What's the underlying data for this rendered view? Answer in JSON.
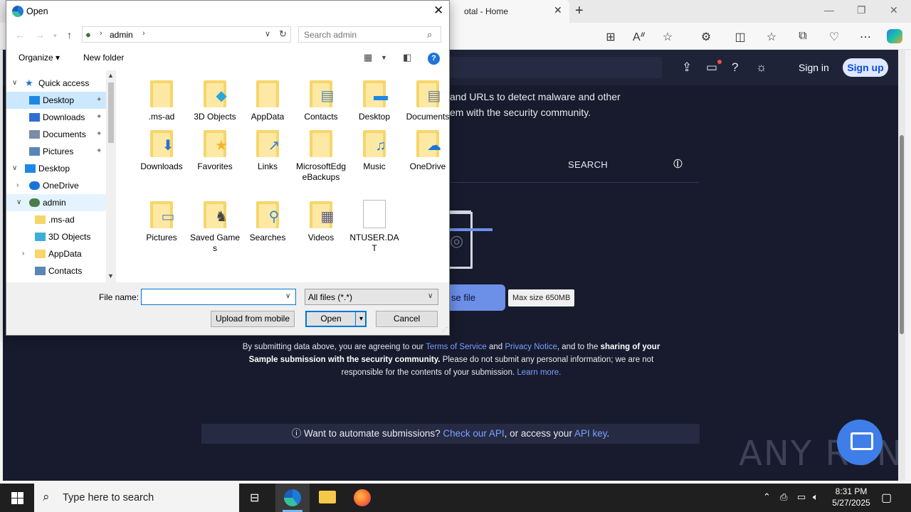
{
  "browser": {
    "tab_title": "otal - Home",
    "new_tab_symbol": "+",
    "window_controls": [
      "—",
      "❐",
      "✕"
    ]
  },
  "vt": {
    "sign_in": "Sign in",
    "sign_up": "Sign up",
    "intro_line1": "and URLs to detect malware and other",
    "intro_line2": "em with the security community.",
    "search_tab": "SEARCH",
    "choose_file": "se file",
    "max_size": "Max size 650MB",
    "consent": {
      "part1": "By submitting data above, you are agreeing to our ",
      "terms": "Terms of Service",
      "part2": " and ",
      "privacy": "Privacy Notice",
      "part3": ", and to the ",
      "bold1": "sharing of your Sample submission with the security community.",
      "part4": " Please do not submit any personal information; we are not responsible for the contents of your submission. ",
      "learn_more": "Learn more."
    },
    "api_banner": {
      "icon": "ⓘ",
      "text1": "Want to automate submissions? ",
      "link1": "Check our API",
      "text2": ", or access your ",
      "link2": "API key",
      "text3": "."
    },
    "watermark": "ANY RUN"
  },
  "dialog": {
    "title": "Open",
    "address": "admin",
    "search_placeholder": "Search admin",
    "organize": "Organize ▾",
    "new_folder": "New folder",
    "help": "?",
    "nav": [
      {
        "label": "Quick access",
        "icon": "star-icon",
        "color": "#1f73d6",
        "level": 0,
        "expanded": true
      },
      {
        "label": "Desktop",
        "icon": "desktop-icon",
        "color": "#1e88e5",
        "level": 1,
        "pinned": true,
        "state": "selected"
      },
      {
        "label": "Downloads",
        "icon": "download-icon",
        "color": "#2f6fd0",
        "level": 1,
        "pinned": true
      },
      {
        "label": "Documents",
        "icon": "document-icon",
        "color": "#7a8ca6",
        "level": 1,
        "pinned": true
      },
      {
        "label": "Pictures",
        "icon": "picture-icon",
        "color": "#5a86b5",
        "level": 1,
        "pinned": true
      },
      {
        "label": "Desktop",
        "icon": "desktop-icon",
        "color": "#1e88e5",
        "level": 0,
        "expanded": true
      },
      {
        "label": "OneDrive",
        "icon": "cloud-icon",
        "color": "#1a73d9",
        "level": 1,
        "collapsed": true
      },
      {
        "label": "admin",
        "icon": "user-icon",
        "color": "#4a7d4a",
        "level": 1,
        "expanded": true,
        "state": "hover"
      },
      {
        "label": ".ms-ad",
        "icon": "folder-icon",
        "color": "#f6d56a",
        "level": 2
      },
      {
        "label": "3D Objects",
        "icon": "cube-icon",
        "color": "#3ab0d9",
        "level": 2
      },
      {
        "label": "AppData",
        "icon": "folder-icon",
        "color": "#f6d56a",
        "level": 2,
        "collapsed": true
      },
      {
        "label": "Contacts",
        "icon": "contact-card-icon",
        "color": "#5a86b5",
        "level": 2
      }
    ],
    "files": [
      {
        "name": ".ms-ad",
        "type": "folder",
        "overlay": ""
      },
      {
        "name": "3D Objects",
        "type": "folder",
        "overlay": "cube"
      },
      {
        "name": "AppData",
        "type": "folder",
        "overlay": ""
      },
      {
        "name": "Contacts",
        "type": "folder",
        "overlay": "contact"
      },
      {
        "name": "Desktop",
        "type": "folder",
        "overlay": "desktop"
      },
      {
        "name": "Documents",
        "type": "folder",
        "overlay": "document"
      },
      {
        "name": "Downloads",
        "type": "folder",
        "overlay": "download"
      },
      {
        "name": "Favorites",
        "type": "folder",
        "overlay": "star"
      },
      {
        "name": "Links",
        "type": "folder",
        "overlay": "link"
      },
      {
        "name": "MicrosoftEdgeBackups",
        "type": "folder",
        "overlay": ""
      },
      {
        "name": "Music",
        "type": "folder",
        "overlay": "music"
      },
      {
        "name": "OneDrive",
        "type": "folder",
        "overlay": "cloud"
      },
      {
        "name": "Pictures",
        "type": "folder",
        "overlay": "picture"
      },
      {
        "name": "Saved Games",
        "type": "folder",
        "overlay": "chess"
      },
      {
        "name": "Searches",
        "type": "folder",
        "overlay": "search"
      },
      {
        "name": "Videos",
        "type": "folder",
        "overlay": "film"
      },
      {
        "name": "NTUSER.DAT",
        "type": "file",
        "overlay": ""
      }
    ],
    "file_name_label": "File name:",
    "file_name_value": "",
    "file_type": "All files (*.*)",
    "upload_mobile": "Upload from mobile",
    "open": "Open",
    "cancel": "Cancel"
  },
  "taskbar": {
    "search_placeholder": "Type here to search",
    "time": "8:31 PM",
    "date": "5/27/2025"
  }
}
